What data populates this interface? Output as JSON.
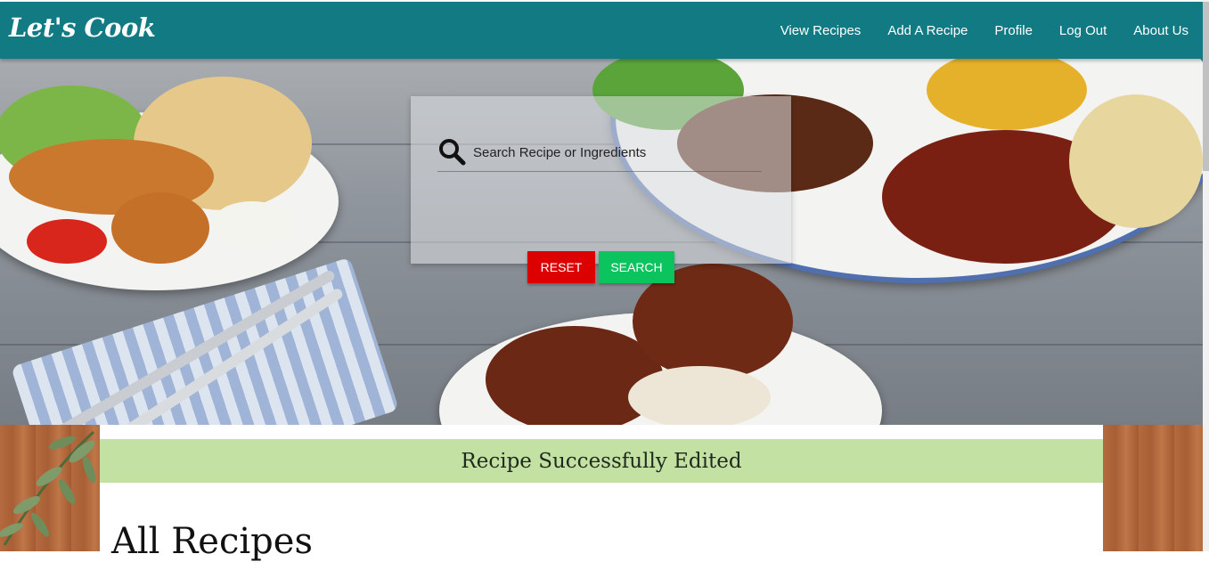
{
  "navbar": {
    "brand": "Let's Cook",
    "links": [
      "View Recipes",
      "Add A Recipe",
      "Profile",
      "Log Out",
      "About Us"
    ],
    "color": "#117a83"
  },
  "search": {
    "placeholder": "Search Recipe or Ingredients",
    "icon": "search-icon",
    "reset_label": "RESET",
    "search_label": "SEARCH",
    "reset_color": "#dd0000",
    "search_color": "#0cc45e"
  },
  "alert": {
    "message": "Recipe Successfully Edited",
    "color": "#c4e1a4"
  },
  "main": {
    "heading": "All Recipes"
  }
}
